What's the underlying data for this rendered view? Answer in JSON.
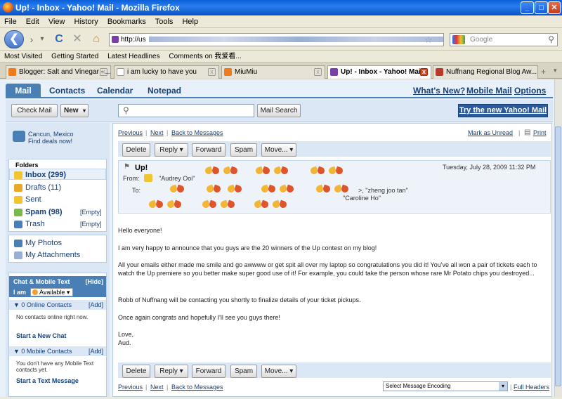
{
  "window": {
    "title": "Up! - Inbox - Yahoo! Mail - Mozilla Firefox"
  },
  "menu": [
    "File",
    "Edit",
    "View",
    "History",
    "Bookmarks",
    "Tools",
    "Help"
  ],
  "nav": {
    "url_prefix": "http://us",
    "search_placeholder": "Google"
  },
  "bookmarks": [
    "Most Visited",
    "Getting Started",
    "Latest Headlines",
    "Comments on 我爱看..."
  ],
  "tabs": [
    {
      "label": "Blogger: Salt and Vinegar - ...",
      "color": "#f07a1c"
    },
    {
      "label": "i am lucky to have you",
      "color": "#dddddd"
    },
    {
      "label": "MiuMiu",
      "color": "#f07a1c"
    },
    {
      "label": "Up! - Inbox - Yahoo! Mail",
      "color": "#7b3fa8"
    },
    {
      "label": "Nuffnang Regional Blog Aw...",
      "color": "#b83a2a"
    }
  ],
  "mail": {
    "tabs": [
      "Mail",
      "Contacts",
      "Calendar",
      "Notepad"
    ],
    "top_links": {
      "whats_new": "What's New?",
      "mobile": "Mobile Mail",
      "options": "Options"
    },
    "check_mail": "Check Mail",
    "new": "New",
    "search_button": "Mail Search",
    "try_new": "Try the new Yahoo! Mail"
  },
  "promo": {
    "line1": "Cancun, Mexico",
    "line2": "Find deals now!"
  },
  "folders": {
    "heading": "Folders",
    "items": [
      {
        "label": "Inbox (299)",
        "color": "#f2c430",
        "bold": true
      },
      {
        "label": "Drafts (11)",
        "color": "#e8a828",
        "bold": false
      },
      {
        "label": "Sent",
        "color": "#f2c430",
        "bold": false
      },
      {
        "label": "Spam (98)",
        "color": "#7ab84a",
        "bold": true,
        "empty": "[Empty]"
      },
      {
        "label": "Trash",
        "color": "#4a7fb6",
        "bold": false,
        "empty": "[Empty]"
      }
    ],
    "extra": [
      {
        "label": "My Photos",
        "color": "#4a7fb6"
      },
      {
        "label": "My Attachments",
        "color": "#9ab0d2"
      }
    ]
  },
  "chat": {
    "heading": "Chat & Mobile Text",
    "hide": "[Hide]",
    "iam": "I am",
    "status": "Available",
    "online": "0 Online Contacts",
    "add": "[Add]",
    "none_online": "No contacts online right now.",
    "start_chat": "Start a New Chat",
    "mobile": "0 Mobile Contacts",
    "no_mobile": "You don't have any Mobile Text contacts yet.",
    "start_text": "Start a Text Message"
  },
  "message": {
    "prev": "Previous",
    "next": "Next",
    "back": "Back to Messages",
    "mark_unread": "Mark as Unread",
    "print": "Print",
    "actions": [
      "Delete",
      "Reply",
      "Forward",
      "Spam",
      "Move..."
    ],
    "subject": "Up!",
    "date": "Tuesday, July 28, 2009 11:32 PM",
    "from_label": "From:",
    "from": "\"Audrey Ooi\"",
    "to_label": "To:",
    "to_visible": ">, \"zheng joo tan\"",
    "to_visible2": "\"Caroline Ho\"",
    "body": [
      "Hello everyone!",
      "I am very happy to announce that you guys are the 20 winners of the Up contest on my blog!",
      "All your emails either made me smile and go awwww or get spit all over my laptop so congratulations you did it!  You've all won a pair of tickets each to watch the Up premiere so you better make super good use of it!  For example, you could take the person whose rare Mr Potato chips you destroyed...",
      "Robb of Nuffnang will be contacting you shortly to finalize details of your ticket pickups.",
      "Once again congrats and hopefully I'll see you guys there!",
      "Love,",
      "Aud."
    ],
    "encoding": "Select Message Encoding",
    "full_headers": "Full Headers"
  }
}
